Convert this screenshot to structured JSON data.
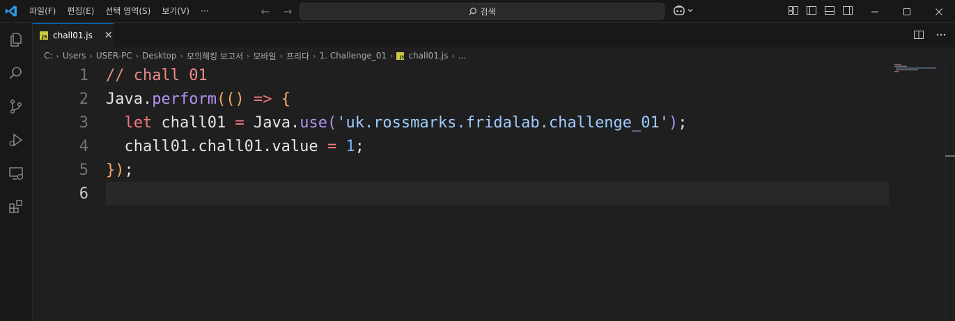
{
  "titlebar": {
    "menu": [
      "파일(F)",
      "편집(E)",
      "선택 영역(S)",
      "보기(V)",
      "···"
    ],
    "search_label": "검색"
  },
  "tab": {
    "filename": "chall01.js",
    "badge": "JS"
  },
  "breadcrumb": {
    "parts": [
      "C:",
      "Users",
      "USER-PC",
      "Desktop",
      "모의해킹 보고서",
      "모바일",
      "프리다",
      "1. Challenge_01"
    ],
    "file": "chall01.js",
    "tail": "..."
  },
  "editor": {
    "line_numbers": [
      "1",
      "2",
      "3",
      "4",
      "5",
      "6"
    ],
    "active_line": "6",
    "lines": {
      "l1": {
        "comment": "// chall 01"
      },
      "l2": {
        "obj": "Java",
        "dot": ".",
        "fn": "perform",
        "p_open": "(()",
        "arrow": " => ",
        "brace": "{"
      },
      "l3": {
        "indent": "  ",
        "kw": "let",
        "var": " chall01 ",
        "eq": "=",
        "obj": " Java",
        "dot": ".",
        "fn": "use",
        "p_open": "(",
        "str": "'uk.rossmarks.fridalab.challenge_01'",
        "p_close": ")",
        "semi": ";"
      },
      "l4": {
        "indent": "  ",
        "expr": "chall01.chall01.value ",
        "eq": "=",
        "num": " 1",
        "semi": ";"
      },
      "l5": {
        "brace": "}",
        "paren": ")",
        "semi": ";"
      }
    }
  },
  "colors": {
    "accent": "#0078d4",
    "js_badge": "#cbcb41",
    "background": "#1f1f1f"
  }
}
